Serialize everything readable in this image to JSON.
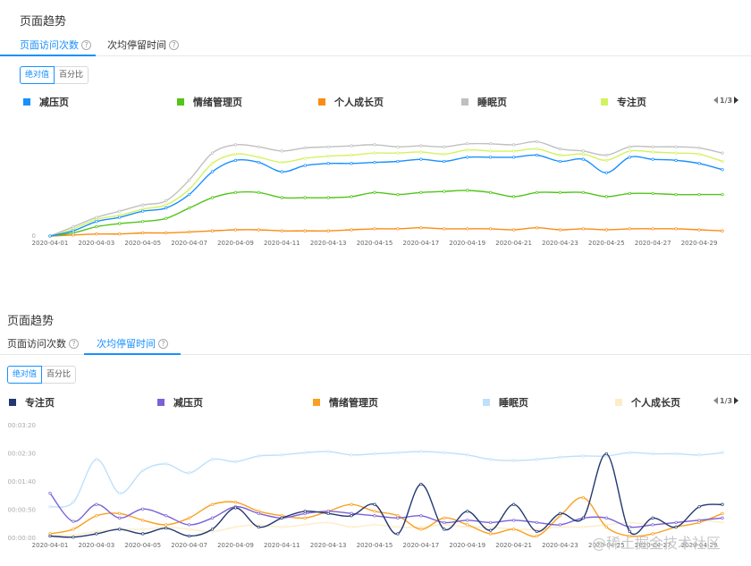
{
  "panel1": {
    "title": "页面趋势",
    "tabs": [
      {
        "label": "页面访问次数",
        "active": true
      },
      {
        "label": "次均停留时间",
        "active": false
      }
    ],
    "toggle": [
      {
        "label": "绝对值",
        "active": true
      },
      {
        "label": "百分比",
        "active": false
      }
    ],
    "pager": "1/3"
  },
  "panel2": {
    "title": "页面趋势",
    "tabs": [
      {
        "label": "页面访问次数",
        "active": false
      },
      {
        "label": "次均停留时间",
        "active": true
      }
    ],
    "toggle": [
      {
        "label": "绝对值",
        "active": true
      },
      {
        "label": "百分比",
        "active": false
      }
    ],
    "pager": "1/3"
  },
  "help_icon": "question-circle-icon",
  "watermark": "@稀土掘金技术社区",
  "chart_data": [
    {
      "type": "line",
      "ylim": [
        0,
        100
      ],
      "grid": false,
      "legend_position": "top",
      "x": [
        "2020-04-01",
        "2020-04-02",
        "2020-04-03",
        "2020-04-04",
        "2020-04-05",
        "2020-04-06",
        "2020-04-07",
        "2020-04-08",
        "2020-04-09",
        "2020-04-10",
        "2020-04-11",
        "2020-04-12",
        "2020-04-13",
        "2020-04-14",
        "2020-04-15",
        "2020-04-16",
        "2020-04-17",
        "2020-04-18",
        "2020-04-19",
        "2020-04-20",
        "2020-04-21",
        "2020-04-22",
        "2020-04-23",
        "2020-04-24",
        "2020-04-25",
        "2020-04-26",
        "2020-04-27",
        "2020-04-28",
        "2020-04-29",
        "2020-04-30"
      ],
      "xticks": [
        "2020-04-01",
        "2020-04-03",
        "2020-04-05",
        "2020-04-07",
        "2020-04-09",
        "2020-04-11",
        "2020-04-13",
        "2020-04-15",
        "2020-04-17",
        "2020-04-19",
        "2020-04-21",
        "2020-04-23",
        "2020-04-25",
        "2020-04-27",
        "2020-04-29"
      ],
      "yticks": [
        "0"
      ],
      "series": [
        {
          "name": "减压页",
          "color": "#1890ff",
          "values": [
            0,
            5,
            14,
            18,
            24,
            27,
            40,
            62,
            73,
            71,
            62,
            68,
            70,
            70,
            71,
            72,
            74,
            72,
            76,
            76,
            76,
            78,
            72,
            74,
            61,
            76,
            74,
            73,
            70,
            64
          ]
        },
        {
          "name": "情绪管理页",
          "color": "#52c41a",
          "values": [
            0,
            3,
            9,
            12,
            14,
            17,
            27,
            37,
            42,
            42,
            37,
            37,
            37,
            38,
            42,
            40,
            42,
            43,
            44,
            42,
            38,
            42,
            42,
            42,
            38,
            41,
            41,
            40,
            40,
            40
          ]
        },
        {
          "name": "个人成长页",
          "color": "#fa8c16",
          "values": [
            0,
            1,
            2,
            2,
            3,
            3,
            4,
            5,
            6,
            6,
            5,
            5,
            5,
            6,
            7,
            7,
            8,
            7,
            7,
            7,
            6,
            8,
            6,
            7,
            6,
            7,
            7,
            7,
            6,
            5
          ]
        },
        {
          "name": "睡眠页",
          "color": "#c0c0c0",
          "values": [
            0,
            9,
            18,
            24,
            30,
            34,
            54,
            80,
            88,
            86,
            82,
            85,
            86,
            87,
            88,
            86,
            87,
            86,
            89,
            89,
            88,
            91,
            84,
            82,
            78,
            86,
            86,
            86,
            85,
            80
          ]
        },
        {
          "name": "专注页",
          "color": "#d3f261",
          "values": [
            0,
            7,
            16,
            20,
            26,
            30,
            45,
            70,
            79,
            76,
            71,
            75,
            77,
            78,
            80,
            80,
            81,
            79,
            83,
            82,
            82,
            84,
            78,
            79,
            73,
            82,
            81,
            80,
            79,
            72
          ]
        }
      ]
    },
    {
      "type": "line",
      "ylim": [
        0,
        100
      ],
      "grid": false,
      "legend_position": "top",
      "x": [
        "2020-04-01",
        "2020-04-02",
        "2020-04-03",
        "2020-04-04",
        "2020-04-05",
        "2020-04-06",
        "2020-04-07",
        "2020-04-08",
        "2020-04-09",
        "2020-04-10",
        "2020-04-11",
        "2020-04-12",
        "2020-04-13",
        "2020-04-14",
        "2020-04-15",
        "2020-04-16",
        "2020-04-17",
        "2020-04-18",
        "2020-04-19",
        "2020-04-20",
        "2020-04-21",
        "2020-04-22",
        "2020-04-23",
        "2020-04-24",
        "2020-04-25",
        "2020-04-26",
        "2020-04-27",
        "2020-04-28",
        "2020-04-29",
        "2020-04-30"
      ],
      "xticks": [
        "2020-04-01",
        "2020-04-03",
        "2020-04-05",
        "2020-04-07",
        "2020-04-09",
        "2020-04-11",
        "2020-04-13",
        "2020-04-15",
        "2020-04-17",
        "2020-04-19",
        "2020-04-21",
        "2020-04-23",
        "2020-04-25",
        "2020-04-27",
        "2020-04-29"
      ],
      "yticks": [
        "00:00:00",
        "00:00:50",
        "00:01:40",
        "00:02:30",
        "00:03:20"
      ],
      "series": [
        {
          "name": "专注页",
          "color": "#233872",
          "values": [
            2,
            1,
            4,
            8,
            4,
            9,
            2,
            8,
            27,
            10,
            18,
            24,
            22,
            20,
            30,
            4,
            48,
            8,
            24,
            7,
            30,
            6,
            22,
            18,
            75,
            6,
            18,
            10,
            28,
            30
          ]
        },
        {
          "name": "减压页",
          "color": "#7b61d8",
          "values": [
            40,
            15,
            30,
            18,
            26,
            20,
            12,
            18,
            28,
            22,
            18,
            22,
            24,
            22,
            20,
            18,
            20,
            14,
            16,
            14,
            16,
            14,
            12,
            18,
            18,
            10,
            12,
            14,
            16,
            18
          ]
        },
        {
          "name": "情绪管理页",
          "color": "#faa020",
          "values": [
            4,
            8,
            20,
            22,
            16,
            12,
            18,
            30,
            32,
            24,
            20,
            18,
            24,
            30,
            24,
            20,
            8,
            18,
            12,
            4,
            8,
            2,
            20,
            36,
            10,
            2,
            4,
            10,
            14,
            22
          ]
        },
        {
          "name": "睡眠页",
          "color": "#bfe0fa",
          "values": [
            28,
            32,
            70,
            40,
            60,
            66,
            58,
            70,
            68,
            73,
            74,
            76,
            77,
            74,
            75,
            76,
            77,
            76,
            74,
            70,
            69,
            70,
            72,
            73,
            73,
            76,
            75,
            75,
            74,
            76
          ]
        },
        {
          "name": "个人成长页",
          "color": "#fcedc8",
          "values": [
            2,
            3,
            6,
            8,
            8,
            10,
            8,
            6,
            10,
            12,
            10,
            12,
            14,
            10,
            12,
            10,
            10,
            12,
            10,
            10,
            8,
            8,
            10,
            10,
            12,
            14,
            12,
            14,
            16,
            14
          ]
        }
      ]
    }
  ]
}
